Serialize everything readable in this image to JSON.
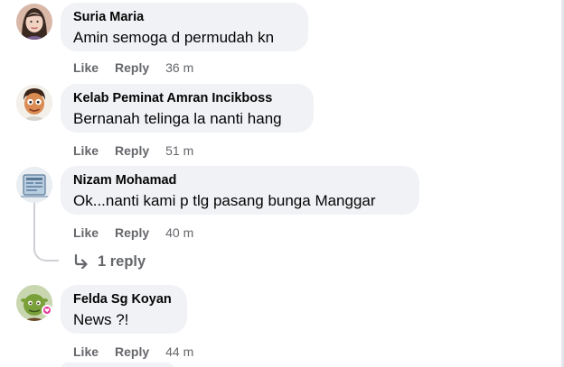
{
  "comments": [
    {
      "author": "Suria Maria",
      "text": "Amin semoga d permudah kn",
      "like": "Like",
      "reply": "Reply",
      "time": "36 m",
      "avatar_icon": "woman-avatar"
    },
    {
      "author": "Kelab Peminat Amran Incikboss",
      "text": "Bernanah telinga la nanti hang",
      "like": "Like",
      "reply": "Reply",
      "time": "51 m",
      "avatar_icon": "cartoon-man-avatar"
    },
    {
      "author": "Nizam Mohamad",
      "text": "Ok...nanti kami p tlg pasang bunga Manggar",
      "like": "Like",
      "reply": "Reply",
      "time": "40 m",
      "avatar_icon": "document-avatar"
    },
    {
      "author": "Felda Sg Koyan",
      "text": "News ?!",
      "like": "Like",
      "reply": "Reply",
      "time": "44 m",
      "avatar_icon": "green-ogre-avatar"
    }
  ],
  "replies_link": "1 reply",
  "colors": {
    "bubble": "#f0f2f5",
    "meta": "#65676b",
    "text": "#050505",
    "badge": "#e7399a"
  }
}
